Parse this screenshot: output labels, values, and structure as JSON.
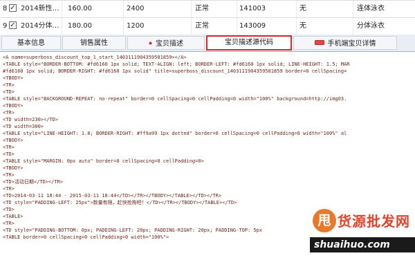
{
  "grid": {
    "rows": [
      {
        "num": "8",
        "checkbox": "✓",
        "name": "2014新性…",
        "price": "160.00",
        "stock": "2400",
        "status": "正常",
        "code": "141003",
        "flag": "无",
        "category": "连体泳衣"
      },
      {
        "num": "9",
        "checkbox": "✓",
        "name": "2014分体…",
        "price": "180.00",
        "stock": "1200",
        "status": "正常",
        "code": "143009",
        "flag": "无",
        "category": "分体泳衣"
      }
    ]
  },
  "tabs": [
    {
      "label": "基本信息"
    },
    {
      "label": "销售属性"
    },
    {
      "label": "宝贝描述"
    },
    {
      "label": "宝贝描述源代码"
    },
    {
      "label": "手机端宝贝详情"
    }
  ],
  "code_lines": [
    "<A name=superboss_discount_top_1_start_1403111904359581859></A>",
    "<TABLE style=\"BORDER-BOTTOM: #fd6160 1px solid; TEXT-ALIGN: left; BORDER-LEFT: #fd6160 1px solid; LINE-HEIGHT: 1.5; MAR",
    "#fd6160 1px solid; BORDER-RIGHT: #fd6160 1px solid\" title=superboss_discount_1403111904359581859 border=0 cellSpacing=",
    "<TBODY>",
    "<TR>",
    "<TD>",
    "<TABLE style=\"BACKGROUND-REPEAT: no-repeat\" border=0 cellSpacing=0 cellPadding=0 width=\"100%\" background=http://img03.",
    "<TBODY>",
    "<TR>",
    "<TD width=230></TD>",
    "<TD width=300>",
    "<TABLE style=\"LINE-HEIGHT: 1.8; BORDER-RIGHT: #ff9a99 1px dotted\" border=0 cellSpacing=0 cellPadding=0 width=\"100%\" al",
    "<TBODY>",
    "<TR>",
    "<TD>",
    "<TABLE style=\"MARGIN: 0px auto\" border=0 cellSpacing=0 cellPadding=0>",
    "<TBODY>",
    "<TR>",
    "<TD>活动日期</TD></TR>",
    "<TR>",
    "<TD>2014-03-11 18:44 - 2015-03-11 18:44</TD></TR></TBODY></TABLE></TD></TR>",
    "<TD style=\"PADDING-LEFT: 25px\">数量有限，赶快抢购吧！</TD></TR></TBODY></TABLE></TD>",
    "<TD>",
    "<TABLE>",
    "<TR>",
    "<TD style=\"PADDING-BOTTOM: 0px; PADDING-LEFT: 20px; PADDING-RIGHT: 20px; PADDING-TOP: 5px",
    "<TABLE border=0 cellSpacing=0 cellPadding=0 width=\"100%\">"
  ],
  "watermark": {
    "logo_char": "甩",
    "brand": "货源批发网",
    "url": "shuaihuo.com"
  },
  "colors": {
    "active_tab_border": "#d62a2a",
    "code_text": "#6a2418",
    "tab_bar": "#e9eef4"
  }
}
